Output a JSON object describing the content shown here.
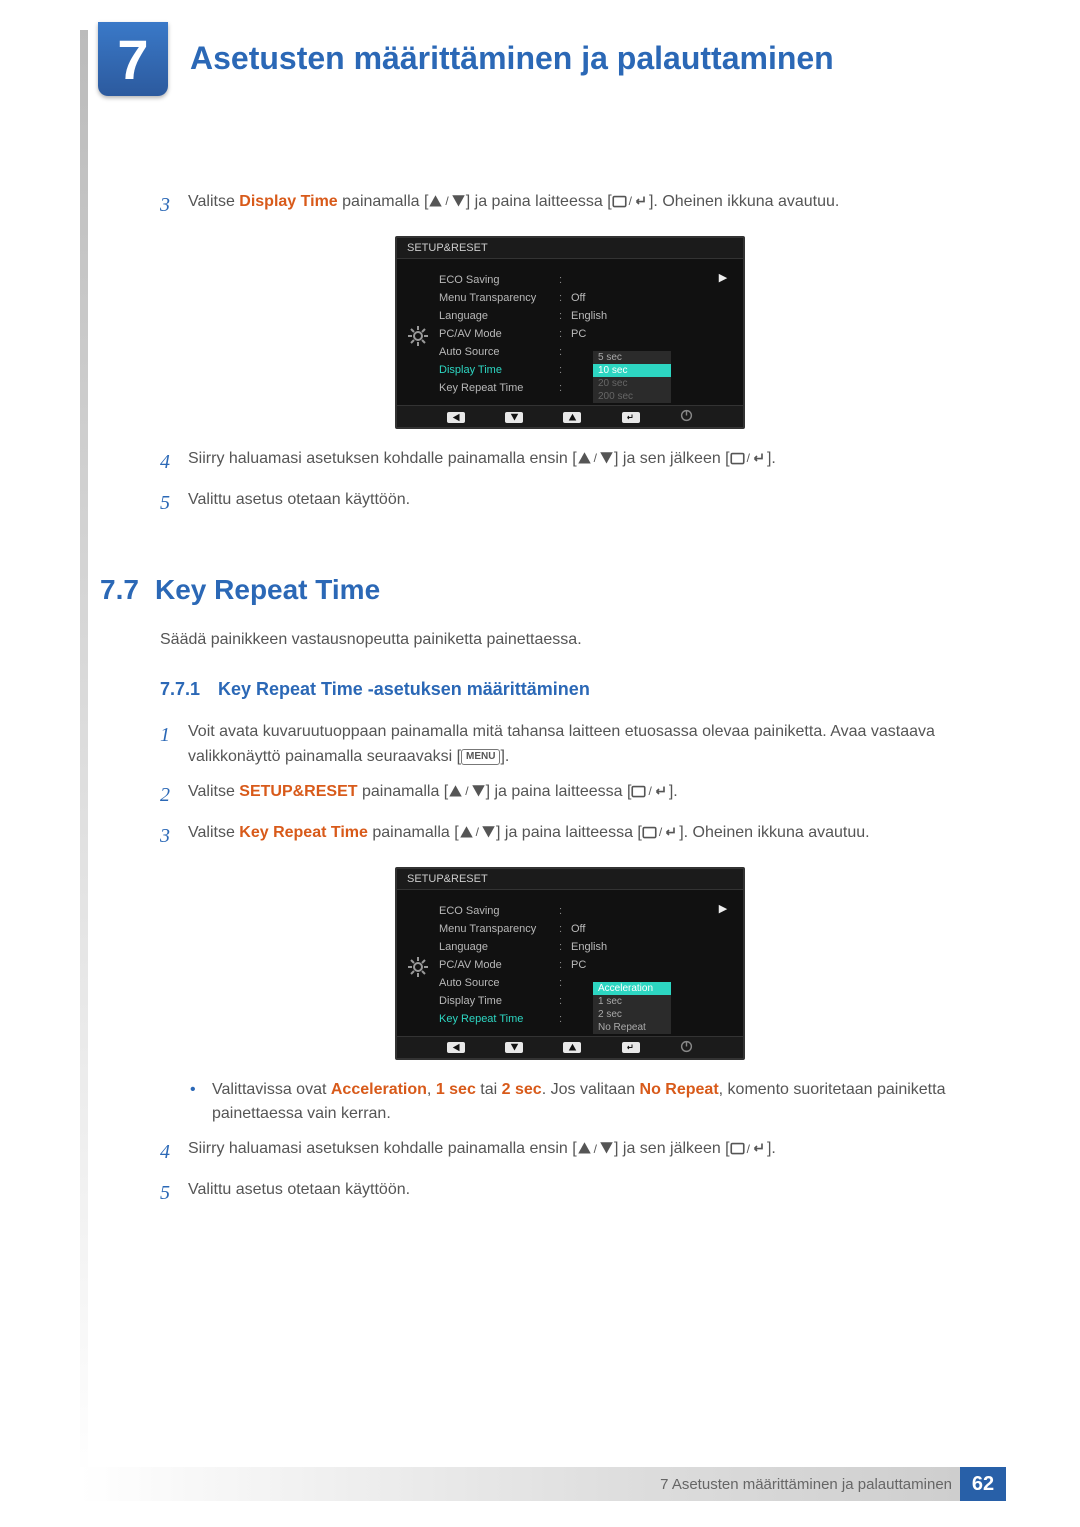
{
  "chapter": {
    "number": "7",
    "title": "Asetusten määrittäminen ja palauttaminen"
  },
  "top_steps": {
    "s3": {
      "num": "3",
      "prefix": "Valitse ",
      "highlight": "Display Time",
      "mid": " painamalla [",
      "mid2": "] ja paina laitteessa [",
      "suffix": "]. Oheinen ikkuna avautuu."
    },
    "s4": {
      "num": "4",
      "prefix": "Siirry haluamasi asetuksen kohdalle painamalla ensin [",
      "mid": "] ja sen jälkeen [",
      "suffix": "]."
    },
    "s5": {
      "num": "5",
      "text": "Valittu asetus otetaan käyttöön."
    }
  },
  "osd1": {
    "title": "SETUP&RESET",
    "rows": [
      {
        "label": "ECO Saving",
        "val": ""
      },
      {
        "label": "Menu Transparency",
        "val": "Off"
      },
      {
        "label": "Language",
        "val": "English"
      },
      {
        "label": "PC/AV Mode",
        "val": "PC"
      },
      {
        "label": "Auto Source",
        "val": ""
      },
      {
        "label": "Display Time",
        "val": "",
        "active": true
      },
      {
        "label": "Key Repeat Time",
        "val": ""
      }
    ],
    "options": [
      {
        "t": "5 sec"
      },
      {
        "t": "10 sec",
        "sel": true
      },
      {
        "t": "20 sec",
        "dim": true
      },
      {
        "t": "200 sec",
        "dim": true
      }
    ]
  },
  "section": {
    "num": "7.7",
    "title": "Key Repeat Time",
    "desc": "Säädä painikkeen vastausnopeutta painiketta painettaessa."
  },
  "subsection": {
    "num": "7.7.1",
    "title": "Key Repeat Time -asetuksen määrittäminen"
  },
  "sub_steps": {
    "s1": {
      "num": "1",
      "line1": "Voit avata kuvaruutuoppaan painamalla mitä tahansa laitteen etuosassa olevaa painiketta. Avaa vastaava valikkonäyttö painamalla seuraavaksi [",
      "menu": "MENU",
      "line1_end": "]."
    },
    "s2": {
      "num": "2",
      "prefix": "Valitse ",
      "highlight": "SETUP&RESET",
      "mid": " painamalla [",
      "mid2": "] ja paina laitteessa [",
      "suffix": "]."
    },
    "s3": {
      "num": "3",
      "prefix": "Valitse ",
      "highlight": "Key Repeat Time",
      "mid": " painamalla [",
      "mid2": "] ja paina laitteessa [",
      "suffix": "]. Oheinen ikkuna avautuu."
    },
    "bullet": {
      "p1": "Valittavissa ovat ",
      "h1": "Acceleration",
      "comma1": ", ",
      "h2": "1 sec",
      "comma2": " tai ",
      "h3": "2 sec",
      "p2": ". Jos valitaan ",
      "h4": "No Repeat",
      "p3": ", komento suoritetaan painiketta painettaessa vain kerran."
    },
    "s4": {
      "num": "4",
      "prefix": "Siirry haluamasi asetuksen kohdalle painamalla ensin [",
      "mid": "] ja sen jälkeen [",
      "suffix": "]."
    },
    "s5": {
      "num": "5",
      "text": "Valittu asetus otetaan käyttöön."
    }
  },
  "osd2": {
    "title": "SETUP&RESET",
    "rows": [
      {
        "label": "ECO Saving",
        "val": ""
      },
      {
        "label": "Menu Transparency",
        "val": "Off"
      },
      {
        "label": "Language",
        "val": "English"
      },
      {
        "label": "PC/AV Mode",
        "val": "PC"
      },
      {
        "label": "Auto Source",
        "val": ""
      },
      {
        "label": "Display Time",
        "val": ""
      },
      {
        "label": "Key Repeat Time",
        "val": "",
        "active": true
      }
    ],
    "options": [
      {
        "t": "Acceleration",
        "sel": true
      },
      {
        "t": "1 sec"
      },
      {
        "t": "2 sec"
      },
      {
        "t": "No Repeat"
      }
    ]
  },
  "footer": {
    "chapter": "7 Asetusten määrittäminen ja palauttaminen",
    "page": "62"
  }
}
